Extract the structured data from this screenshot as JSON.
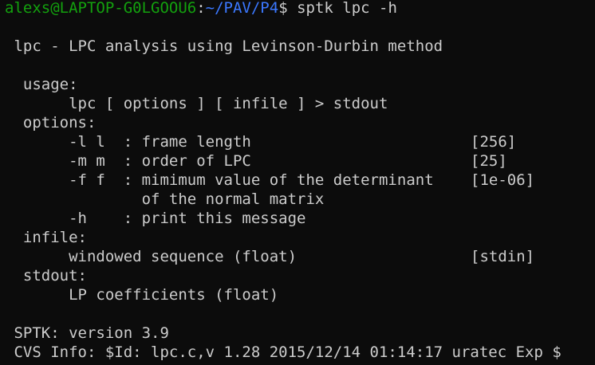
{
  "prompt": {
    "user_host": "alexs@LAPTOP-G0LGOOU6",
    "separator": ":",
    "path": "~/PAV/P4",
    "symbol": "$",
    "command": " sptk lpc -h"
  },
  "output": {
    "title": " lpc - LPC analysis using Levinson-Durbin method",
    "usage_header": "  usage:",
    "usage_line": "       lpc [ options ] [ infile ] > stdout",
    "options_header": "  options:",
    "options": [
      {
        "text": "       -l l  : frame length",
        "default": "[256]"
      },
      {
        "text": "       -m m  : order of LPC",
        "default": "[25]"
      },
      {
        "text": "       -f f  : mimimum value of the determinant",
        "default": "[1e-06]"
      },
      {
        "text": "               of the normal matrix",
        "default": ""
      },
      {
        "text": "       -h    : print this message",
        "default": ""
      }
    ],
    "infile_header": "  infile:",
    "infile_line": {
      "text": "       windowed sequence (float)",
      "default": "[stdin]"
    },
    "stdout_header": "  stdout:",
    "stdout_line": "       LP coefficients (float)",
    "version": " SPTK: version 3.9",
    "cvs_info": " CVS Info: $Id: lpc.c,v 1.28 2015/12/14 01:14:17 uratec Exp $"
  },
  "colors": {
    "background": "#0c0c0c",
    "text": "#cccccc",
    "user_host": "#13a10e",
    "path": "#3b78ff"
  }
}
